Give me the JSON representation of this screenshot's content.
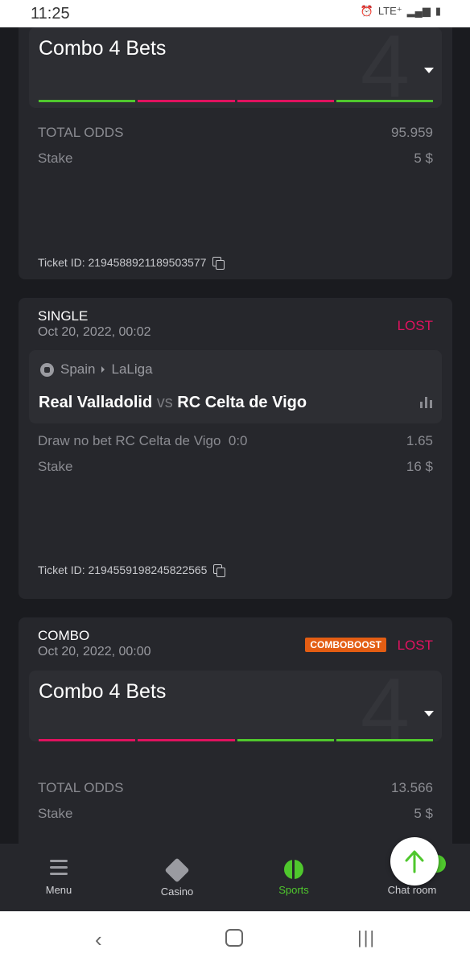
{
  "statusbar": {
    "time": "11:25",
    "network": "LTE⁺"
  },
  "tickets": [
    {
      "combo_title": "Combo 4 Bets",
      "big_number": "4",
      "bar_colors": [
        "#4fc72d",
        "#e0125f",
        "#e0125f",
        "#4fc72d"
      ],
      "total_odds_label": "TOTAL ODDS",
      "total_odds_value": "95.959",
      "stake_label": "Stake",
      "stake_value": "5 $",
      "ticket_id": "Ticket ID: 2194588921189503577"
    },
    {
      "type": "SINGLE",
      "date": "Oct 20, 2022, 00:02",
      "status": "LOST",
      "country": "Spain",
      "league": "LaLiga",
      "home": "Real Valladolid",
      "vs": "vs",
      "away": "RC Celta de Vigo",
      "market": "Draw no bet RC Celta de Vigo  0:0",
      "odds": "1.65",
      "stake_label": "Stake",
      "stake_value": "16 $",
      "ticket_id": "Ticket ID: 2194559198245822565"
    },
    {
      "type": "COMBO",
      "date": "Oct 20, 2022, 00:00",
      "boost": "COMBOBOOST",
      "status": "LOST",
      "combo_title": "Combo 4 Bets",
      "big_number": "4",
      "bar_colors": [
        "#e0125f",
        "#e0125f",
        "#4fc72d",
        "#4fc72d"
      ],
      "total_odds_label": "TOTAL ODDS",
      "total_odds_value": "13.566",
      "stake_label": "Stake",
      "stake_value": "5 $"
    }
  ],
  "nav": {
    "menu": "Menu",
    "casino": "Casino",
    "sports": "Sports",
    "chat": "Chat room"
  },
  "colors": {
    "accent_green": "#4fc72d",
    "lost_red": "#e0125f",
    "boost_orange": "#e35d13"
  }
}
